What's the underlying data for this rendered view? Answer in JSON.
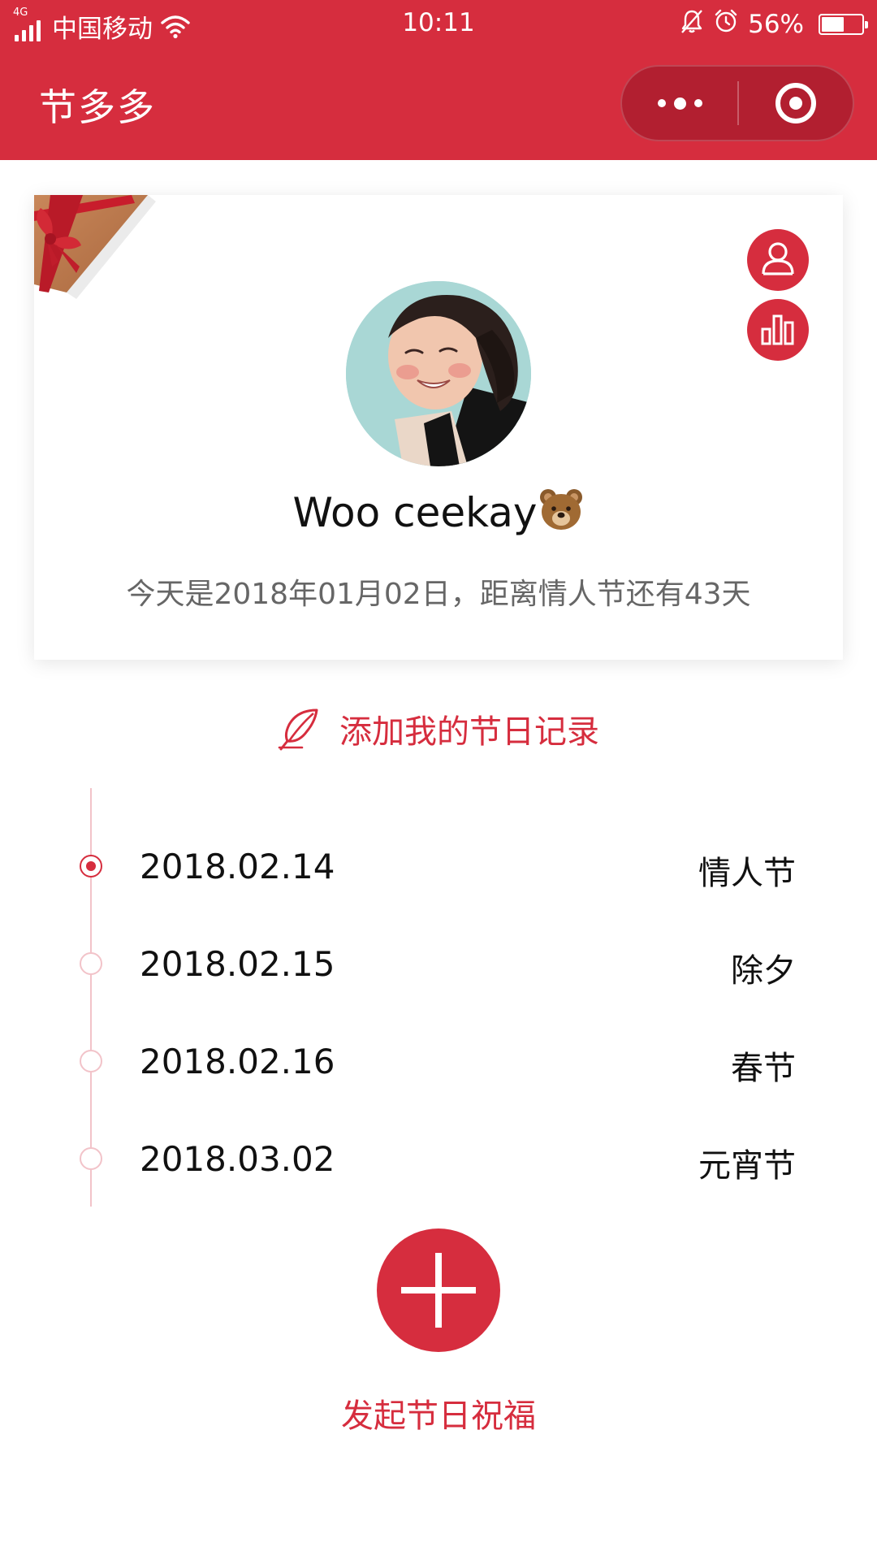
{
  "status_bar": {
    "network_type": "4G",
    "carrier": "中国移动",
    "time": "10:11",
    "battery": "56%",
    "battery_level": 0.56
  },
  "nav": {
    "title": "节多多",
    "more_icon": "more-dots-icon",
    "close_icon": "target-close-icon"
  },
  "profile": {
    "username": "Woo ceekay",
    "username_emoji": "bear-emoji",
    "today_message": "今天是2018年01月02日，距离情人节还有43天",
    "user_icon": "user-icon",
    "stats_icon": "bar-chart-icon"
  },
  "add_record": {
    "label": "添加我的节日记录",
    "icon": "quill-icon"
  },
  "holidays": [
    {
      "date": "2018.02.14",
      "name": "情人节",
      "active": true
    },
    {
      "date": "2018.02.15",
      "name": "除夕",
      "active": false
    },
    {
      "date": "2018.02.16",
      "name": "春节",
      "active": false
    },
    {
      "date": "2018.03.02",
      "name": "元宵节",
      "active": false
    }
  ],
  "send_greeting": {
    "label": "发起节日祝福",
    "icon": "plus-icon"
  },
  "colors": {
    "brand_red": "#d62d3e",
    "capsule_red": "#b21f30",
    "timeline_pink": "#f2c3c9",
    "muted_text": "#666666"
  }
}
